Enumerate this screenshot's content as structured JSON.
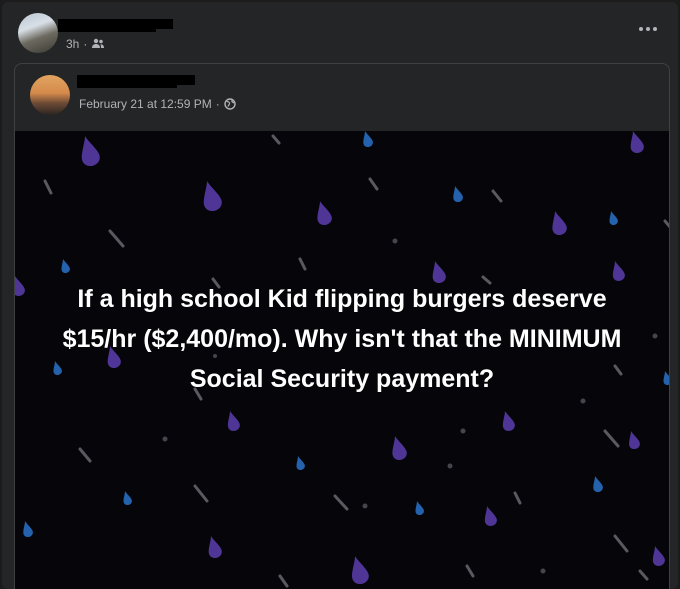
{
  "outer_post": {
    "timestamp": "3h",
    "separator": "·",
    "audience_icon": "friends-icon",
    "more_icon": "more-options-icon"
  },
  "shared_post": {
    "timestamp": "February 21 at 12:59 PM",
    "separator": "·",
    "audience_icon": "globe-icon",
    "image_text": "If a high school Kid flipping burgers deserve $15/hr ($2,400/mo). Why isn't that the MINIMUM Social Security payment?"
  },
  "colors": {
    "card_bg": "#242526",
    "image_bg": "#06060a",
    "drop_purple": "#5b3ea8",
    "drop_blue": "#2c6fb8",
    "meta_text": "#b0b3b8"
  }
}
